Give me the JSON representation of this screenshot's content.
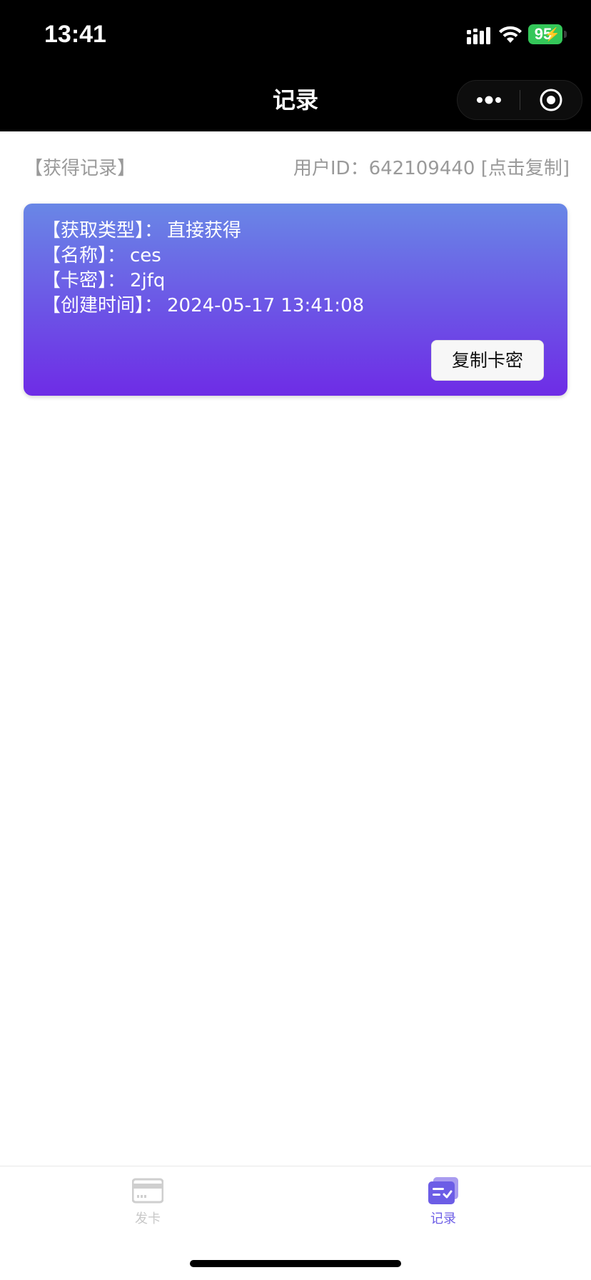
{
  "status_bar": {
    "time": "13:41",
    "battery": "95"
  },
  "nav": {
    "title": "记录"
  },
  "header": {
    "records_label": "【获得记录】",
    "user_id_text": "用户ID：642109440 [点击复制]"
  },
  "record": {
    "type_label": "【获取类型】：",
    "type_value": "直接获得",
    "name_label": "【名称】：",
    "name_value": "ces",
    "code_label": "【卡密】：",
    "code_value": "2jfq",
    "created_label": "【创建时间】：",
    "created_value": "2024-05-17 13:41:08",
    "copy_button": "复制卡密"
  },
  "tabs": [
    {
      "label": "发卡",
      "icon": "card-icon",
      "active": false
    },
    {
      "label": "记录",
      "icon": "records-icon",
      "active": true
    }
  ],
  "colors": {
    "accent": "#6c5de6",
    "card_gradient_top": "#6987e6",
    "card_gradient_bottom": "#6e2ce6",
    "battery": "#34c759"
  }
}
